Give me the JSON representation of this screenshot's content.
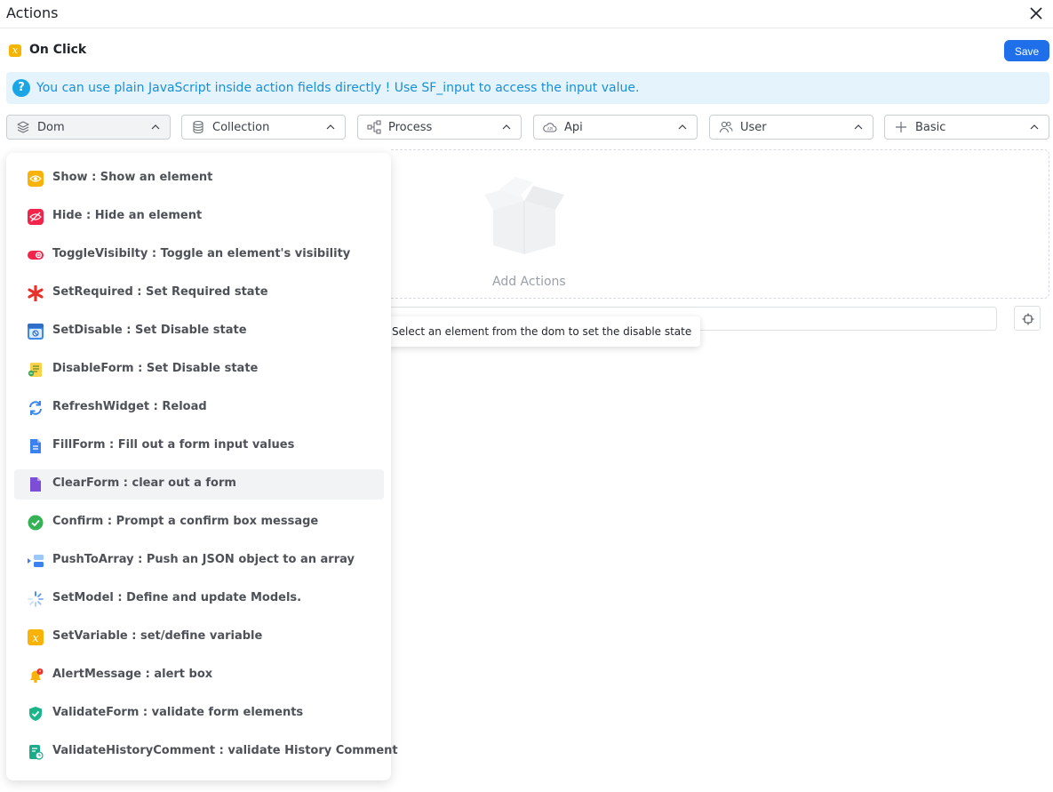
{
  "window": {
    "title": "Actions"
  },
  "event": {
    "name": "On Click"
  },
  "toolbar": {
    "save_label": "Save"
  },
  "banner": {
    "message": "You can use plain JavaScript inside action fields directly ! Use SF_input to access the input value."
  },
  "categories": [
    {
      "label": "Dom",
      "icon": "database-icon"
    },
    {
      "label": "Collection",
      "icon": "cylinder-icon"
    },
    {
      "label": "Process",
      "icon": "process-icon"
    },
    {
      "label": "Api",
      "icon": "cloud-api-icon"
    },
    {
      "label": "User",
      "icon": "users-icon"
    },
    {
      "label": "Basic",
      "icon": "plus-icon"
    }
  ],
  "dropzone": {
    "label": "Add Actions"
  },
  "tooltip": {
    "text": "Select an element from the dom to set the disable state"
  },
  "actions": [
    {
      "label": "Show : Show an element",
      "icon": "eye-icon"
    },
    {
      "label": "Hide : Hide an element",
      "icon": "eye-off-icon"
    },
    {
      "label": "ToggleVisibilty : Toggle an element's visibility",
      "icon": "toggle-icon"
    },
    {
      "label": "SetRequired : Set Required state",
      "icon": "asterisk-icon"
    },
    {
      "label": "SetDisable : Set Disable state",
      "icon": "disabled-window-icon"
    },
    {
      "label": "DisableForm : Set Disable state",
      "icon": "form-disable-icon"
    },
    {
      "label": "RefreshWidget : Reload",
      "icon": "refresh-icon"
    },
    {
      "label": "FillForm : Fill out a form input values",
      "icon": "document-icon"
    },
    {
      "label": "ClearForm : clear out a form",
      "icon": "clear-document-icon"
    },
    {
      "label": "Confirm : Prompt a confirm box message",
      "icon": "check-circle-icon"
    },
    {
      "label": "PushToArray : Push an JSON object to an array",
      "icon": "push-array-icon"
    },
    {
      "label": "SetModel : Define and update Models.",
      "icon": "spinner-icon"
    },
    {
      "label": "SetVariable : set/define variable",
      "icon": "variable-icon"
    },
    {
      "label": "AlertMessage : alert box",
      "icon": "bell-alert-icon"
    },
    {
      "label": "ValidateForm : validate form elements",
      "icon": "shield-check-icon"
    },
    {
      "label": "ValidateHistoryComment : validate History Comment",
      "icon": "history-check-icon"
    }
  ],
  "colors": {
    "accent": "#1f6feb",
    "banner_bg": "#e5f3fd",
    "banner_text": "#1890d5"
  }
}
